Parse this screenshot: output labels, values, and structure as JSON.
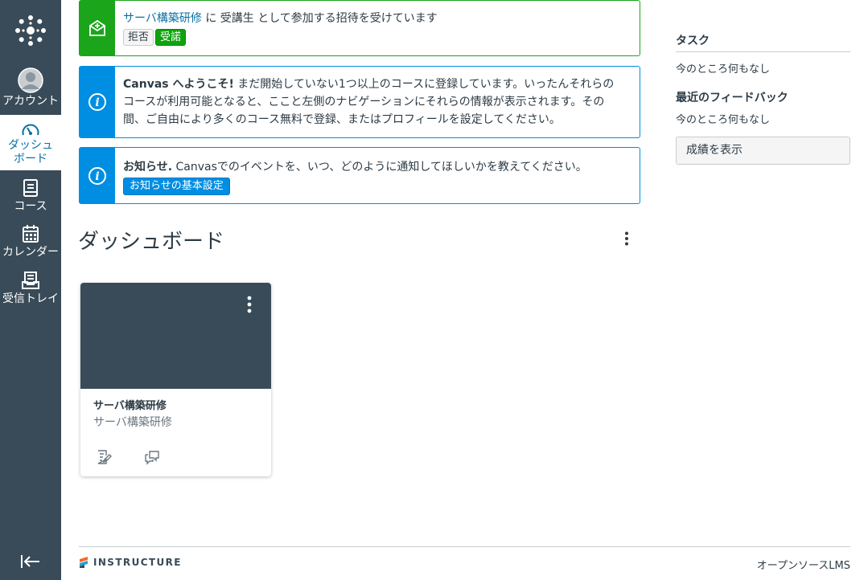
{
  "nav": {
    "account": "アカウント",
    "dashboard_line1": "ダッシュ",
    "dashboard_line2": "ボード",
    "courses": "コース",
    "calendar": "カレンダー",
    "inbox": "受信トレイ"
  },
  "invite": {
    "course_link": "サーバ構築研修",
    "text": " に 受講生 として参加する招待を受けています",
    "decline": "拒否",
    "accept": "受諾"
  },
  "welcome": {
    "bold": "Canvas へようこそ!",
    "line1": " まだ開始していない1つ以上のコースに登録しています。いったんそれらの",
    "line2": "コースが利用可能となると、ここと左側のナビゲーションにそれらの情報が表示されます。その",
    "line3": "間、ご自由により多くのコース無料で登録、またはプロフィールを設定してください。"
  },
  "notice": {
    "bold": "お知らせ.",
    "text": " Canvasでのイベントを、いつ、どのように通知してほしいかを教えてください。",
    "button": "お知らせの基本設定"
  },
  "dashboard": {
    "title": "ダッシュボード"
  },
  "card": {
    "title": "サーバ構築研修",
    "subtitle": "サーバ構築研修",
    "color": "#394b58"
  },
  "sidebar": {
    "tasks_heading": "タスク",
    "tasks_empty": "今のところ何もなし",
    "feedback_heading": "最近のフィードバック",
    "feedback_empty": "今のところ何もなし",
    "grades_button": "成績を表示"
  },
  "footer": {
    "logo_text": "INSTRUCTURE",
    "link": "オープンソースLMS"
  },
  "colors": {
    "nav_bg": "#394b58",
    "success": "#1ba51b",
    "info": "#008ee2",
    "link": "#0770a3"
  }
}
